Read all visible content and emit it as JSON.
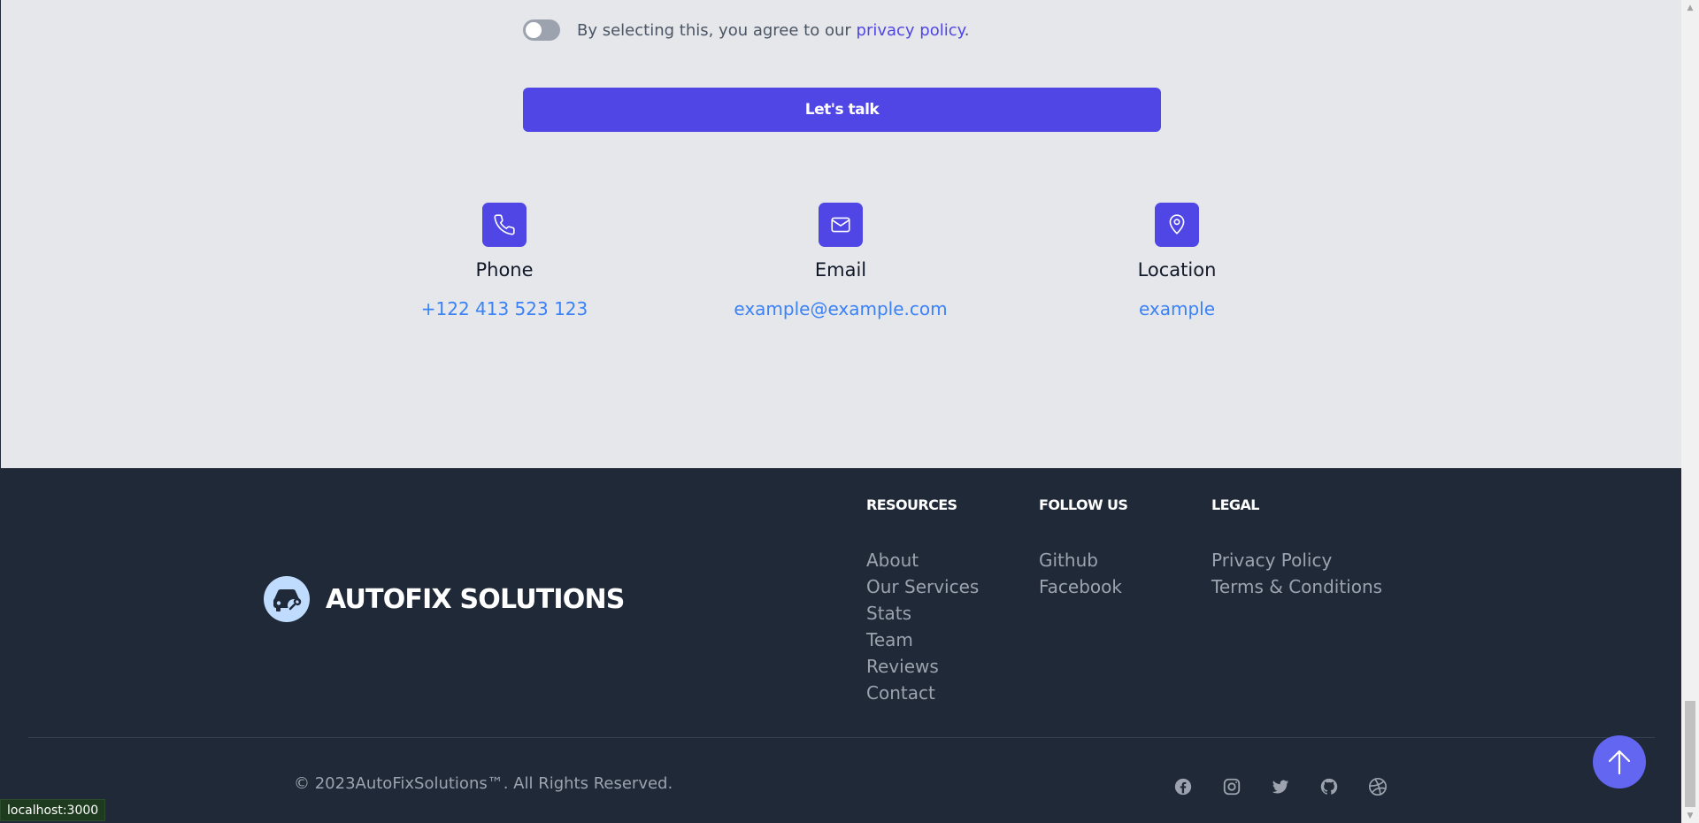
{
  "contact": {
    "consent_text": "By selecting this, you agree to our ",
    "consent_link": "privacy policy",
    "consent_end": ".",
    "cta_label": "Let's talk",
    "cards": [
      {
        "title": "Phone",
        "value": "+122 413 523 123",
        "icon": "phone-icon"
      },
      {
        "title": "Email",
        "value": "example@example.com",
        "icon": "mail-icon"
      },
      {
        "title": "Location",
        "value": "example",
        "icon": "map-pin-icon"
      }
    ]
  },
  "footer": {
    "brand": "AUTOFIX SOLUTIONS",
    "brand_icon": "car-wrench-icon",
    "columns": [
      {
        "title": "RESOURCES",
        "items": [
          "About",
          "Our Services",
          "Stats",
          "Team",
          "Reviews",
          "Contact"
        ]
      },
      {
        "title": "FOLLOW US",
        "items": [
          "Github",
          "Facebook"
        ]
      },
      {
        "title": "LEGAL",
        "items": [
          "Privacy Policy",
          "Terms & Conditions"
        ]
      }
    ],
    "copyright": "© 2023AutoFixSolutions™. All Rights Reserved.",
    "socials": [
      "facebook-icon",
      "instagram-icon",
      "twitter-icon",
      "github-icon",
      "dribbble-icon"
    ]
  },
  "status_tip": "localhost:3000",
  "colors": {
    "accent": "#4f46e5",
    "link": "#3b82f6",
    "footer_bg": "#1f2937",
    "section_bg": "#e5e7eb",
    "scroll_button": "#6366f1"
  }
}
